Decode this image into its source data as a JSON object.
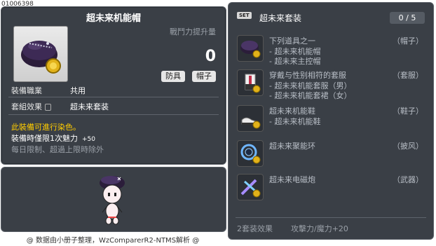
{
  "item_id": "01006398",
  "tooltip": {
    "title": "超未来机能帽",
    "cp_label": "戰鬥力提升量",
    "cp_value": "0",
    "tags": [
      "防具",
      "帽子"
    ],
    "job_label": "裝備職業",
    "job_value": "共用",
    "set_label": "套組效果",
    "set_value": "超未来套装",
    "dye_text": "此裝備可進行染色。",
    "equip_text": "裝備時僅限1次魅力",
    "equip_value": "+50",
    "daily_text": "每日限制、超過上限時除外"
  },
  "footer": "@ 数据由小册子整理，WzComparerR2-NTMS解析 @",
  "set_panel": {
    "badge": "SET",
    "name": "超未来套装",
    "count": "0 / 5",
    "items": [
      {
        "title": "下列道具之一",
        "sub": [
          "- 超未来机能帽",
          "- 超未来主控帽"
        ],
        "category": "（帽子）"
      },
      {
        "title": "穿戴与性别相符的套服",
        "sub": [
          "- 超未来机能套服（男）",
          "- 超未来机能套裙（女）"
        ],
        "category": "（套服）"
      },
      {
        "title": "超未来机能鞋",
        "sub": [
          "- 超未来机能鞋"
        ],
        "category": "（鞋子）"
      },
      {
        "title": "超未来聚能环",
        "sub": [],
        "category": "（披风）"
      },
      {
        "title": "超未来电磁炮",
        "sub": [],
        "category": "（武器）"
      }
    ],
    "bonus_label": "2套装效果",
    "bonus_stat": "攻擊力/魔力",
    "bonus_value": "+20"
  }
}
